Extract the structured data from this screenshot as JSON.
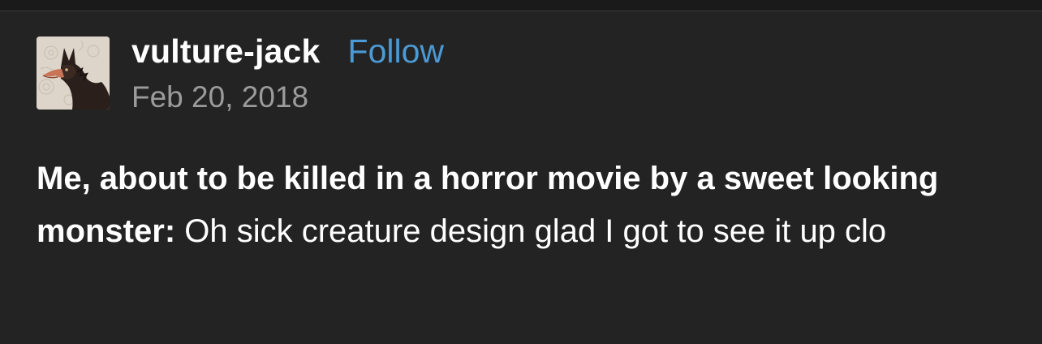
{
  "post": {
    "username": "vulture-jack",
    "follow_label": "Follow",
    "date": "Feb 20, 2018",
    "body_bold": "Me, about to be killed in a horror movie by a sweet looking monster:",
    "body_text": " Oh sick creature design glad I got to see it up clo"
  },
  "colors": {
    "background": "#232323",
    "follow_link": "#4b9ad6",
    "date_text": "#9b9b9b",
    "text": "#ffffff"
  },
  "avatar": {
    "icon": "vulture-creature-avatar"
  }
}
